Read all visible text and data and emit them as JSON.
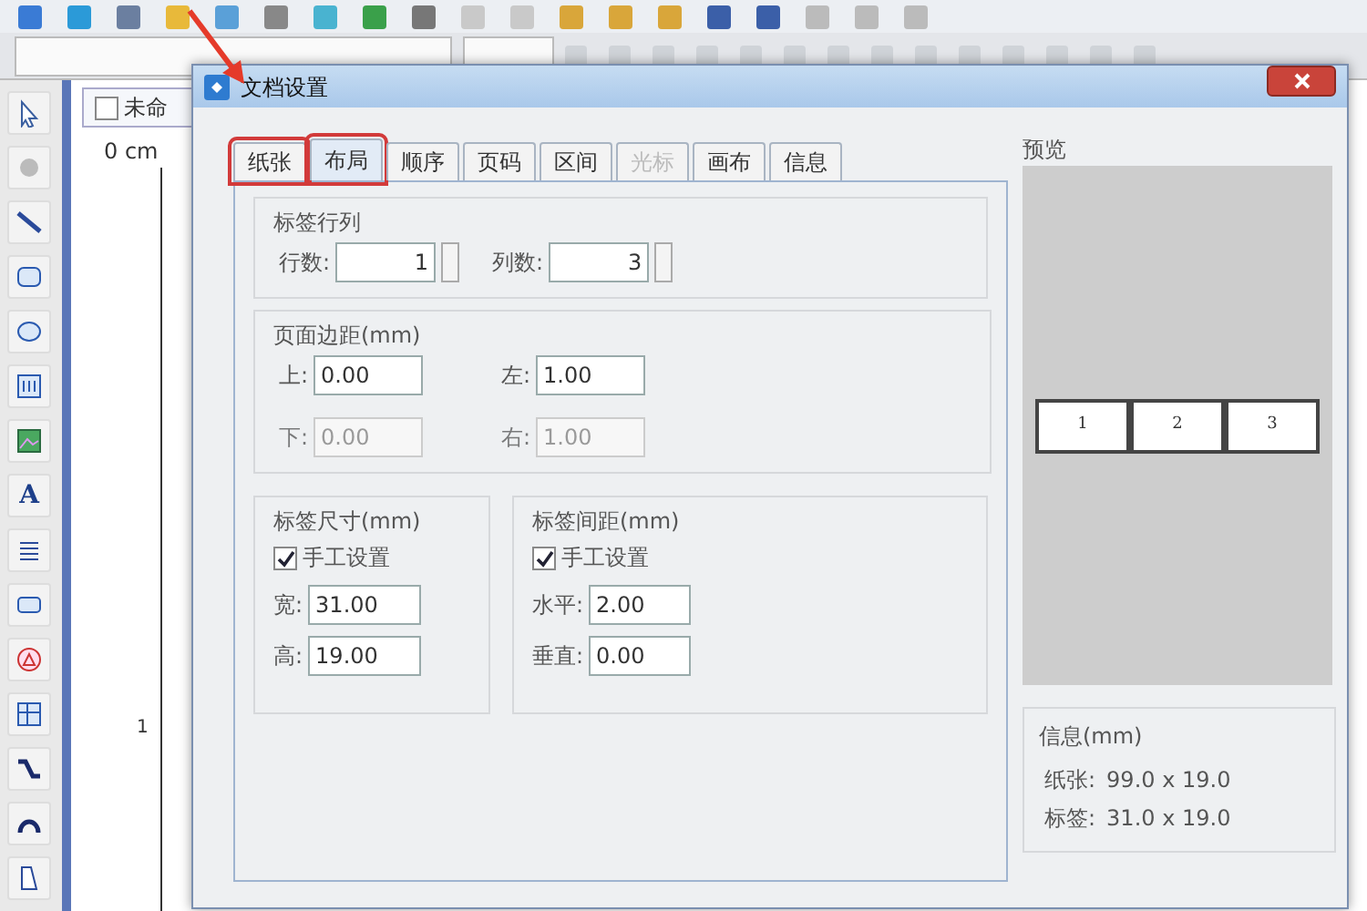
{
  "app": {
    "canvas_tab": "未命",
    "ruler_label": "0 cm",
    "ruler_mark": "1",
    "text_tool": "A"
  },
  "dialog": {
    "title": "文档设置",
    "tabs": [
      {
        "label": "纸张",
        "selected": false,
        "disabled": false,
        "highlighted": true
      },
      {
        "label": "布局",
        "selected": true,
        "disabled": false,
        "highlighted": true
      },
      {
        "label": "顺序",
        "selected": false,
        "disabled": false,
        "highlighted": false
      },
      {
        "label": "页码",
        "selected": false,
        "disabled": false,
        "highlighted": false
      },
      {
        "label": "区间",
        "selected": false,
        "disabled": false,
        "highlighted": false
      },
      {
        "label": "光标",
        "selected": false,
        "disabled": true,
        "highlighted": false
      },
      {
        "label": "画布",
        "selected": false,
        "disabled": false,
        "highlighted": false
      },
      {
        "label": "信息",
        "selected": false,
        "disabled": false,
        "highlighted": false
      }
    ],
    "rows_cols": {
      "title": "标签行列",
      "fields": [
        {
          "label": "行数:",
          "value": "1"
        },
        {
          "label": "列数:",
          "value": "3"
        }
      ]
    },
    "margins": {
      "title": "页面边距(mm)",
      "fields": [
        {
          "label": "上:",
          "value": "0.00",
          "disabled": false
        },
        {
          "label": "左:",
          "value": "1.00",
          "disabled": false
        },
        {
          "label": "下:",
          "value": "0.00",
          "disabled": true
        },
        {
          "label": "右:",
          "value": "1.00",
          "disabled": true
        }
      ]
    },
    "size": {
      "title": "标签尺寸(mm)",
      "manual": {
        "label": "手工设置",
        "checked": true
      },
      "fields": [
        {
          "label": "宽:",
          "value": "31.00"
        },
        {
          "label": "高:",
          "value": "19.00"
        }
      ]
    },
    "gap": {
      "title": "标签间距(mm)",
      "manual": {
        "label": "手工设置",
        "checked": true
      },
      "fields": [
        {
          "label": "水平:",
          "value": "2.00"
        },
        {
          "label": "垂直:",
          "value": "0.00"
        }
      ]
    },
    "preview": {
      "title": "预览",
      "cells": [
        "1",
        "2",
        "3"
      ]
    },
    "info": {
      "title": "信息(mm)",
      "lines": [
        {
          "label": "纸张:",
          "value": "99.0 x 19.0"
        },
        {
          "label": "标签:",
          "value": "31.0 x 19.0"
        }
      ]
    }
  }
}
